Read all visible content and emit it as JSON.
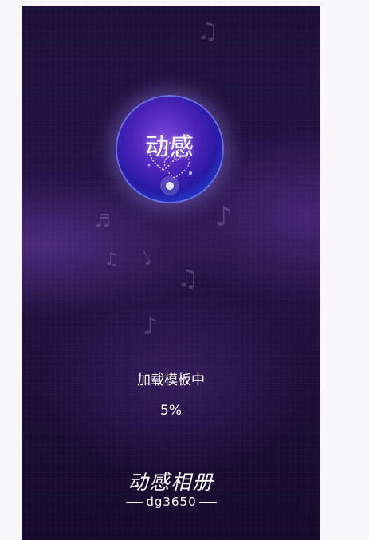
{
  "logo": {
    "text": "动感"
  },
  "loading": {
    "status_text": "加载模板中",
    "progress_text": "5%",
    "progress_percent": 5
  },
  "brand": {
    "title": "动感相册",
    "subtitle": "dg3650"
  },
  "decor": {
    "note_icons": [
      "music-note-icon"
    ]
  },
  "colors": {
    "background_top": "#1d1038",
    "background_mid": "#251446",
    "background_bottom": "#170b2d",
    "orb_inner": "#7a45d8",
    "orb_outer": "#2e7fe8",
    "text": "#ffffff"
  }
}
